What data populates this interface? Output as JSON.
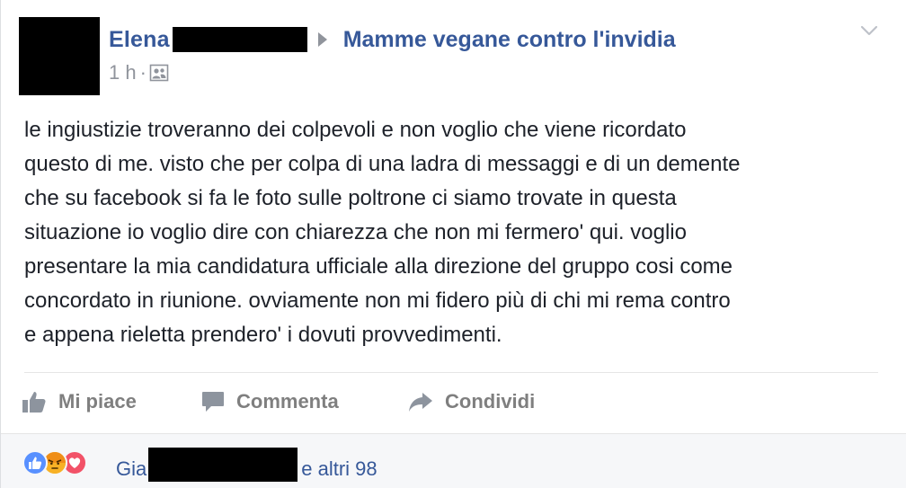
{
  "post": {
    "author": "Elena",
    "group": "Mamme vegane contro l'invidia",
    "time": "1 h",
    "separator": "·",
    "audience_icon": "group-members-icon",
    "menu_icon": "chevron-down-icon",
    "text_lines": [
      "le ingiustizie troveranno dei colpevoli e non voglio che viene ricordato",
      "questo di me. visto che per colpa di una ladra di messaggi e di un demente",
      "che su facebook si fa le foto sulle poltrone ci siamo trovate in questa",
      "situazione io voglio dire con chiarezza che non mi fermero' qui. voglio",
      "presentare la mia candidatura ufficiale alla direzione del gruppo cosi come",
      "concordato in riunione. ovviamente non mi fidero più di chi mi rema contro",
      "e appena rieletta prendero' i dovuti provvedimenti."
    ]
  },
  "actions": {
    "like": "Mi piace",
    "comment": "Commenta",
    "share": "Condividi"
  },
  "reactions": {
    "icons": [
      "like-reaction-icon",
      "angry-reaction-icon",
      "love-reaction-icon"
    ],
    "reactor_prefix": "Gia",
    "others": "e altri 98"
  },
  "colors": {
    "link": "#365899",
    "text": "#1d2129",
    "muted": "#90949c",
    "like_blue": "#5890ff",
    "angry_yellow": "#f7b125",
    "love_red": "#f25268"
  }
}
